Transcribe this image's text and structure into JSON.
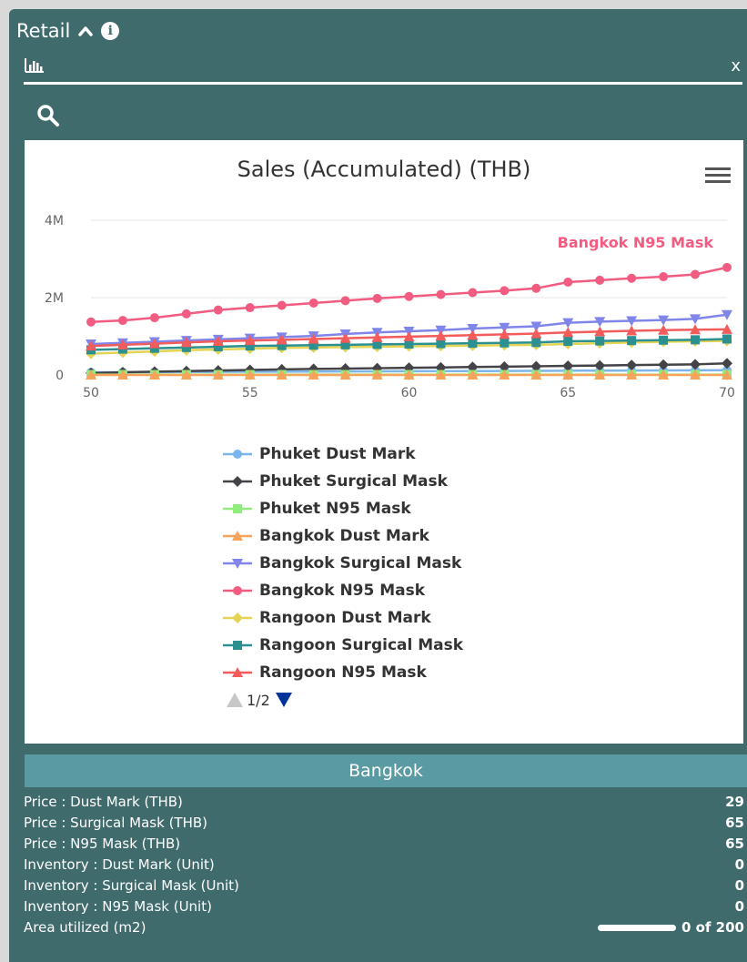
{
  "header": {
    "title": "Retail",
    "caret_icon": "chevron-up-icon",
    "info_icon": "info-icon"
  },
  "toolbar": {
    "chart_icon": "bar-chart-icon",
    "close_label": "x"
  },
  "search": {
    "icon": "search-icon"
  },
  "chart_data": {
    "type": "line",
    "title": "Sales (Accumulated) (THB)",
    "xlabel": "",
    "ylabel": "",
    "x": [
      50,
      51,
      52,
      53,
      54,
      55,
      56,
      57,
      58,
      59,
      60,
      61,
      62,
      63,
      64,
      65,
      66,
      67,
      68,
      69,
      70
    ],
    "xlim": [
      50,
      70
    ],
    "ylim": [
      0,
      4000000
    ],
    "x_ticks": [
      "50",
      "55",
      "60",
      "65",
      "70"
    ],
    "y_ticks": [
      "0",
      "2M",
      "4M"
    ],
    "grid": true,
    "legend_position": "bottom",
    "annotation": "Bangkok N95 Mask",
    "series": [
      {
        "name": "Phuket Dust Mark",
        "color": "#7cb5ec",
        "marker": "circle",
        "values": [
          70000,
          72000,
          75000,
          78000,
          80000,
          83000,
          86000,
          88000,
          91000,
          93000,
          96000,
          99000,
          101000,
          104000,
          107000,
          110000,
          112000,
          115000,
          118000,
          120000,
          123000
        ]
      },
      {
        "name": "Phuket Surgical Mask",
        "color": "#434348",
        "marker": "diamond",
        "values": [
          50000,
          70000,
          85000,
          100000,
          115000,
          130000,
          145000,
          155000,
          165000,
          175000,
          185000,
          195000,
          205000,
          215000,
          225000,
          235000,
          245000,
          255000,
          265000,
          275000,
          300000
        ]
      },
      {
        "name": "Phuket N95 Mask",
        "color": "#90ed7d",
        "marker": "square",
        "values": [
          10000,
          10000,
          10000,
          10000,
          10000,
          10000,
          10000,
          10000,
          10000,
          10000,
          10000,
          10000,
          10000,
          10000,
          10000,
          10000,
          10000,
          10000,
          10000,
          10000,
          10000
        ]
      },
      {
        "name": "Bangkok Dust Mark",
        "color": "#f7a35c",
        "marker": "triangle",
        "values": [
          0,
          0,
          0,
          0,
          0,
          0,
          0,
          0,
          0,
          0,
          0,
          0,
          0,
          0,
          0,
          0,
          0,
          0,
          0,
          0,
          0
        ]
      },
      {
        "name": "Bangkok Surgical Mask",
        "color": "#8085e9",
        "marker": "triangle-down",
        "values": [
          800000,
          830000,
          860000,
          890000,
          920000,
          950000,
          980000,
          1010000,
          1060000,
          1100000,
          1130000,
          1160000,
          1200000,
          1230000,
          1260000,
          1350000,
          1380000,
          1400000,
          1420000,
          1450000,
          1560000
        ]
      },
      {
        "name": "Bangkok N95 Mask",
        "color": "#f15c80",
        "marker": "circle",
        "values": [
          1370000,
          1410000,
          1480000,
          1580000,
          1680000,
          1740000,
          1800000,
          1860000,
          1920000,
          1980000,
          2030000,
          2080000,
          2130000,
          2180000,
          2240000,
          2400000,
          2450000,
          2500000,
          2540000,
          2600000,
          2780000
        ]
      },
      {
        "name": "Rangoon Dust Mark",
        "color": "#e4d354",
        "marker": "diamond",
        "values": [
          550000,
          580000,
          610000,
          640000,
          660000,
          680000,
          700000,
          710000,
          720000,
          730000,
          740000,
          750000,
          760000,
          770000,
          780000,
          800000,
          820000,
          840000,
          860000,
          870000,
          880000
        ]
      },
      {
        "name": "Rangoon Surgical Mask",
        "color": "#2b908f",
        "marker": "square",
        "values": [
          650000,
          670000,
          690000,
          710000,
          730000,
          750000,
          760000,
          770000,
          780000,
          790000,
          800000,
          810000,
          820000,
          830000,
          840000,
          870000,
          880000,
          890000,
          900000,
          910000,
          930000
        ]
      },
      {
        "name": "Rangoon N95 Mask",
        "color": "#f45b5b",
        "marker": "triangle",
        "values": [
          750000,
          780000,
          810000,
          840000,
          870000,
          890000,
          910000,
          930000,
          950000,
          970000,
          990000,
          1010000,
          1030000,
          1050000,
          1070000,
          1100000,
          1120000,
          1140000,
          1160000,
          1170000,
          1180000
        ]
      }
    ]
  },
  "chart_menu_icon": "hamburger-menu-icon",
  "legend_pager": {
    "label": "1/2",
    "up_icon": "triangle-up-icon",
    "down_icon": "triangle-down-icon"
  },
  "city": {
    "name": "Bangkok"
  },
  "stats": [
    {
      "label": "Price : Dust Mark (THB)",
      "value": "29"
    },
    {
      "label": "Price : Surgical Mask (THB)",
      "value": "65"
    },
    {
      "label": "Price : N95 Mask (THB)",
      "value": "65"
    },
    {
      "label": "Inventory : Dust Mark (Unit)",
      "value": "0"
    },
    {
      "label": "Inventory : Surgical Mask (Unit)",
      "value": "0"
    },
    {
      "label": "Inventory : N95 Mask (Unit)",
      "value": "0"
    }
  ],
  "area": {
    "label": "Area utilized (m2)",
    "value": "0 of 200",
    "used": 0,
    "total": 200
  }
}
